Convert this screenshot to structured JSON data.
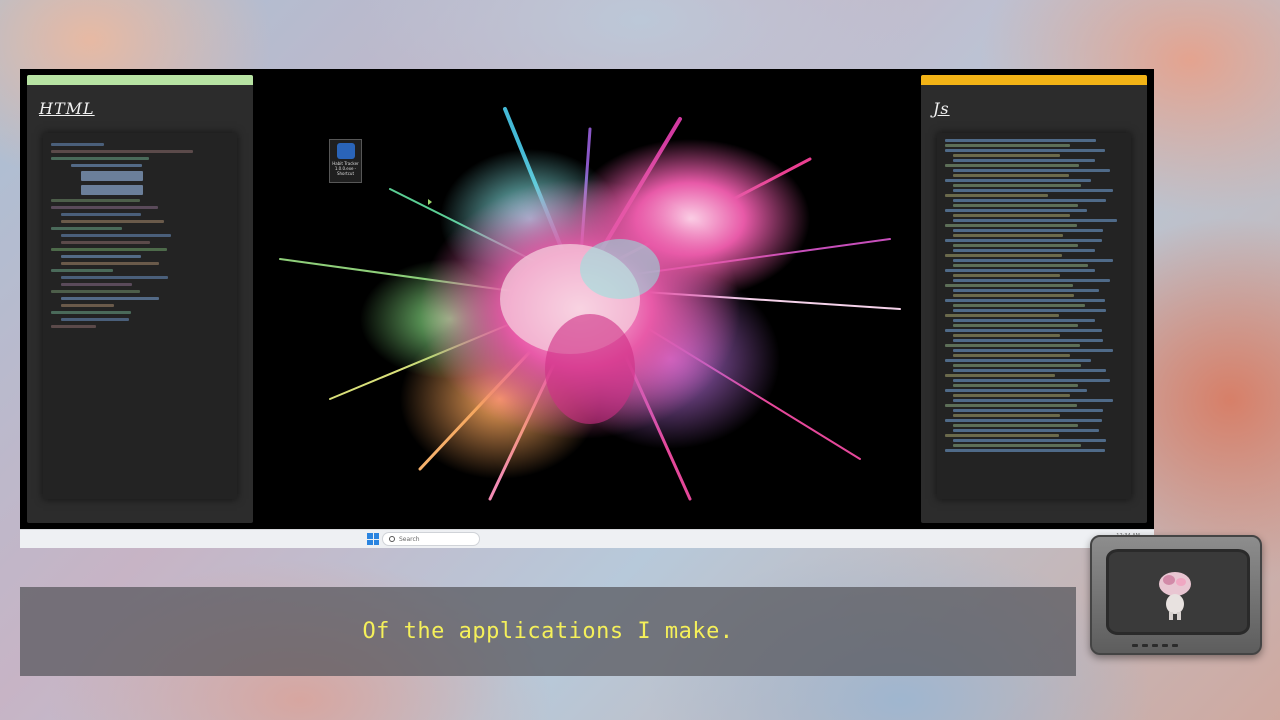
{
  "panels": {
    "left": {
      "title": "HTML",
      "accent": "#b7e3a3"
    },
    "right": {
      "title": "Js",
      "accent": "#f2b316"
    }
  },
  "desktop": {
    "icon_label": "Habit Tracker 1.0.0.exe - Shortcut"
  },
  "taskbar": {
    "search_placeholder": "Search",
    "clock": "12:34 AM"
  },
  "caption": {
    "text": "Of the applications I make.",
    "color": "#f5f05a"
  },
  "icons": [
    "windows-start-icon",
    "search-icon",
    "app-shortcut-icon",
    "tv-icon"
  ]
}
